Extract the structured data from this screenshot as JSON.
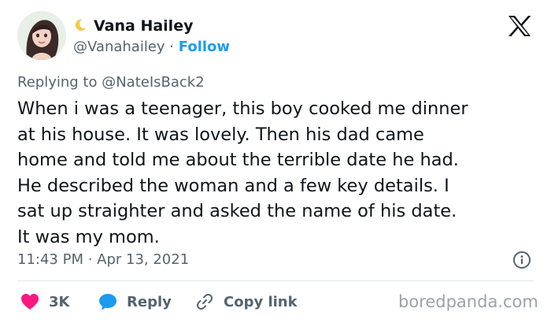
{
  "author": {
    "display_name": "Vana Hailey",
    "handle": "@Vanahailey",
    "separator": "·",
    "follow_label": "Follow",
    "emoji_icon": "crescent-moon-icon"
  },
  "reply_context": {
    "prefix": "Replying to",
    "target": "@NateIsBack2"
  },
  "tweet": {
    "text": "When i was a teenager, this boy cooked me dinner\nat his house. It was lovely. Then his dad came\nhome and told me about the terrible date he had.\nHe described the woman and a few key details. I\nsat up straighter and asked the name of his date.\nIt was my mom.",
    "timestamp": "11:43 PM · Apr 13, 2021"
  },
  "actions": {
    "like_count": "3K",
    "reply_label": "Reply",
    "copy_label": "Copy link"
  },
  "watermark": "boredpanda.com",
  "colors": {
    "accent": "#1d9bf0",
    "like": "#f91880",
    "text": "#0f1419",
    "muted": "#536471"
  }
}
